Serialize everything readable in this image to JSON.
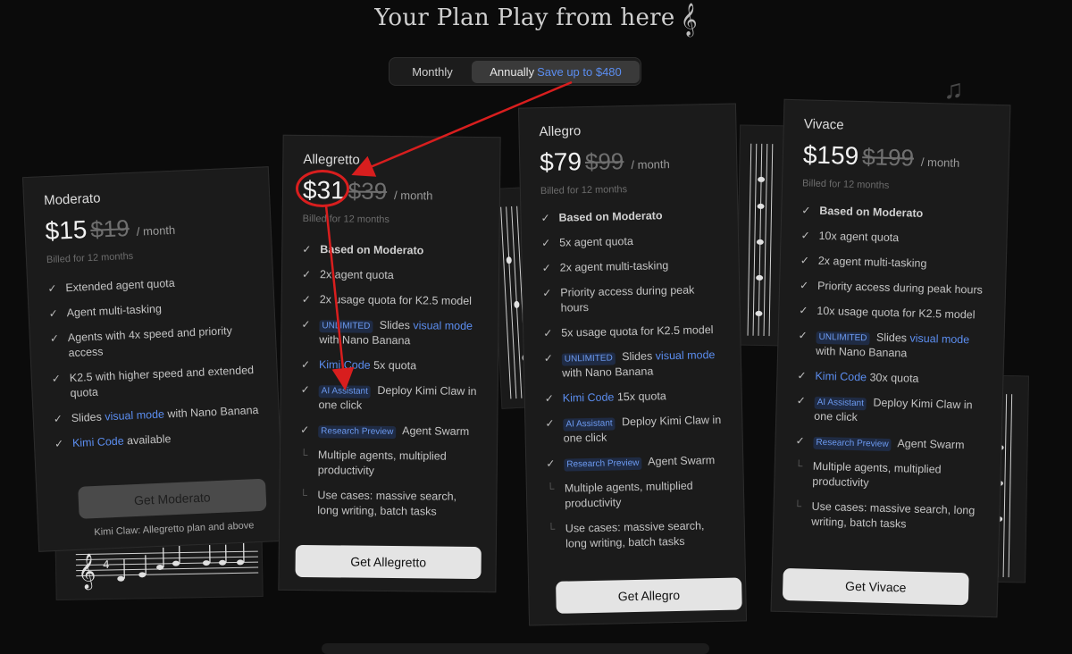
{
  "header": {
    "title": "Your Plan Play from here",
    "clef_icon": "treble-clef-icon"
  },
  "billing_toggle": {
    "monthly_label": "Monthly",
    "annual_label": "Annually",
    "annual_save": "Save up to $480",
    "selected": "Annually"
  },
  "plans": [
    {
      "name": "Moderato",
      "price": "$15",
      "old_price": "$19",
      "per": "/ month",
      "billed": "Billed for 12 months",
      "features": [
        {
          "text": "Extended agent quota"
        },
        {
          "text": "Agent multi-tasking"
        },
        {
          "text": "Agents with 4x speed and priority access"
        },
        {
          "text": "K2.5 with higher speed and extended quota"
        },
        {
          "pre": "Slides ",
          "link": "visual mode",
          "post": " with Nano Banana"
        },
        {
          "link": "Kimi Code",
          "post": " available"
        }
      ],
      "button": "Get Moderato",
      "footnote": "Kimi Claw: Allegretto plan and above"
    },
    {
      "name": "Allegretto",
      "price": "$31",
      "old_price": "$39",
      "per": "/ month",
      "billed": "Billed for 12 months",
      "features": [
        {
          "text": "Based on Moderato",
          "bold": true
        },
        {
          "text": "2x agent quota"
        },
        {
          "text": "2x usage quota for K2.5 model"
        },
        {
          "tag": "UNLIMITED",
          "pre": " Slides ",
          "link": "visual mode",
          "post": " with Nano Banana"
        },
        {
          "link": "Kimi Code",
          "post": " 5x quota"
        },
        {
          "tag": "AI Assistant",
          "pre": " Deploy Kimi Claw in one click"
        },
        {
          "tag": "Research Preview",
          "pre": " Agent Swarm"
        },
        {
          "text": "Multiple agents, multiplied productivity",
          "sub": true
        },
        {
          "text": "Use cases: massive search, long writing, batch tasks",
          "sub": true
        }
      ],
      "button": "Get Allegretto"
    },
    {
      "name": "Allegro",
      "price": "$79",
      "old_price": "$99",
      "per": "/ month",
      "billed": "Billed for 12 months",
      "features": [
        {
          "text": "Based on Moderato",
          "bold": true
        },
        {
          "text": "5x agent quota"
        },
        {
          "text": "2x agent multi-tasking"
        },
        {
          "text": "Priority access during peak hours"
        },
        {
          "text": "5x usage quota for K2.5 model"
        },
        {
          "tag": "UNLIMITED",
          "pre": " Slides ",
          "link": "visual mode",
          "post": " with Nano Banana"
        },
        {
          "link": "Kimi Code",
          "post": " 15x quota"
        },
        {
          "tag": "AI Assistant",
          "pre": " Deploy Kimi Claw in one click"
        },
        {
          "tag": "Research Preview",
          "pre": " Agent Swarm"
        },
        {
          "text": "Multiple agents, multiplied productivity",
          "sub": true
        },
        {
          "text": "Use cases: massive search, long writing, batch tasks",
          "sub": true
        }
      ],
      "button": "Get Allegro"
    },
    {
      "name": "Vivace",
      "price": "$159",
      "old_price": "$199",
      "per": "/ month",
      "billed": "Billed for 12 months",
      "features": [
        {
          "text": "Based on Moderato",
          "bold": true
        },
        {
          "text": "10x agent quota"
        },
        {
          "text": "2x agent multi-tasking"
        },
        {
          "text": "Priority access during peak hours"
        },
        {
          "text": "10x usage quota for K2.5 model"
        },
        {
          "tag": "UNLIMITED",
          "pre": " Slides ",
          "link": "visual mode",
          "post": " with Nano Banana"
        },
        {
          "link": "Kimi Code",
          "post": " 30x quota"
        },
        {
          "tag": "AI Assistant",
          "pre": " Deploy Kimi Claw in one click"
        },
        {
          "tag": "Research Preview",
          "pre": " Agent Swarm"
        },
        {
          "text": "Multiple agents, multiplied productivity",
          "sub": true
        },
        {
          "text": "Use cases: massive search, long writing, batch tasks",
          "sub": true
        }
      ],
      "button": "Get Vivace"
    }
  ],
  "colors": {
    "accent": "#5b8def",
    "annotation": "#d81e1e",
    "background": "#0b0b0b"
  }
}
